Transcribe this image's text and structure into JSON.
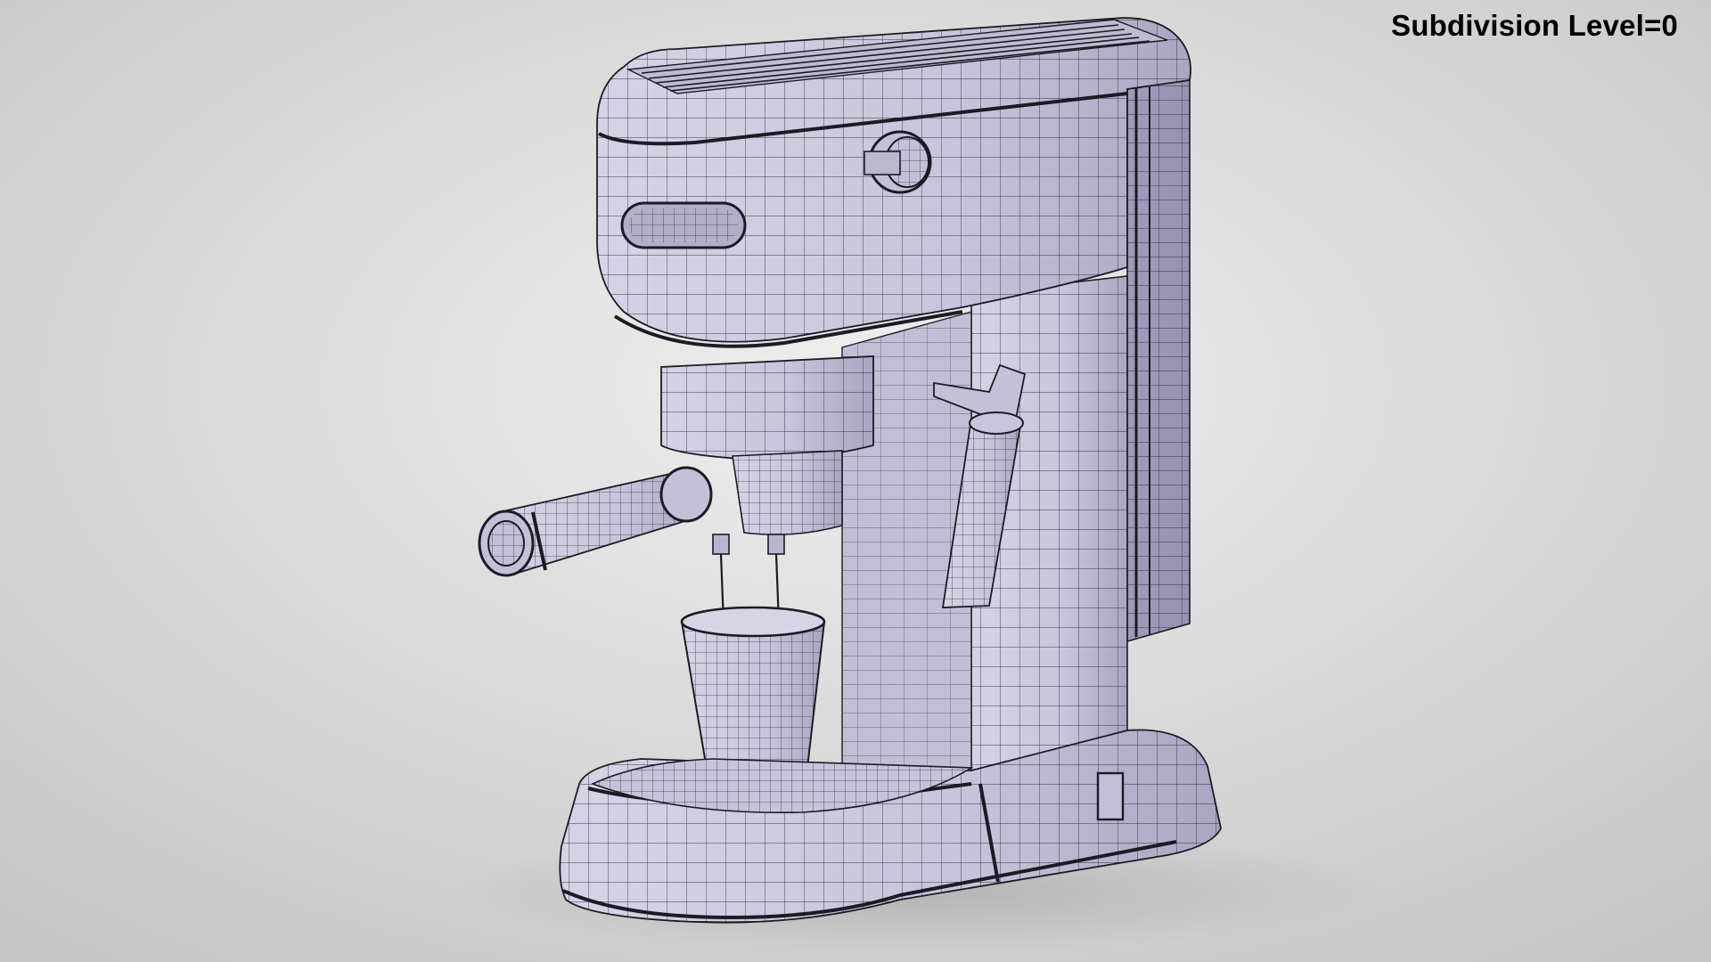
{
  "overlay": {
    "label": "Subdivision Level=0"
  },
  "colors": {
    "background_light": "#ececec",
    "background_dark": "#c7c7c7",
    "mesh_fill": "#cfcbe0",
    "mesh_fill_shadow": "#aaa5c2",
    "wire": "#1b1b24",
    "label_text": "#000000"
  }
}
